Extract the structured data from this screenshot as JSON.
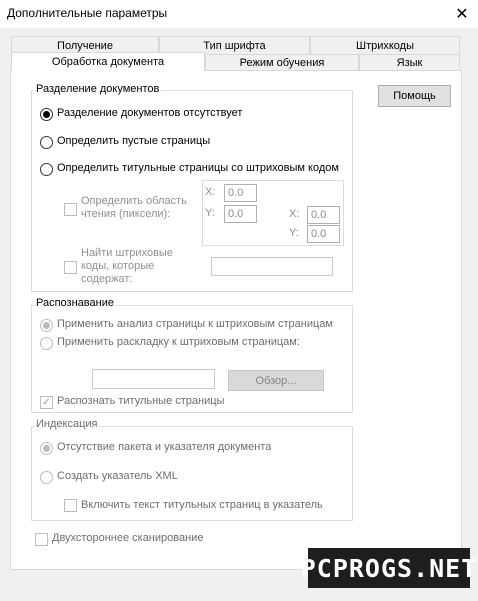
{
  "window": {
    "title": "Дополнительные параметры",
    "close_glyph": "✕"
  },
  "tabs": {
    "row1": [
      "Получение",
      "Тип шрифта",
      "Штрихкоды"
    ],
    "row2": [
      "Обработка документа",
      "Режим обучения",
      "Язык"
    ]
  },
  "help_button": "Помощь",
  "separation": {
    "label": "Разделение документов",
    "options": [
      "Разделение документов отсутствует",
      "Определить пустые страницы",
      "Определить титульные страницы со штриховым кодом"
    ],
    "read_area_label": "Определить область чтения (пиксели):",
    "coords": {
      "x1_label": "X:",
      "x1": "0.0",
      "y1_label": "Y:",
      "y1": "0.0",
      "x2_label": "X:",
      "x2": "0.0",
      "y2_label": "Y:",
      "y2": "0.0"
    },
    "find_barcodes_label": "Найти штриховые коды, которые содержат:",
    "find_barcodes_value": ""
  },
  "recognition": {
    "label": "Распознавание",
    "options": [
      "Применить анализ страницы к штриховым страницам",
      "Применить раскладку к штриховым страницам:"
    ],
    "path_value": "",
    "browse": "Обзор...",
    "recognize_title_label": "Распознать титульные страницы",
    "recognize_title_checkmark": "✓"
  },
  "indexing": {
    "label": "Индексация",
    "options": [
      "Отсутствие пакета и указателя документа",
      "Создать указатель XML"
    ],
    "include_title_text_label": "Включить текст титульных страниц в указатель"
  },
  "duplex_label": "Двухстороннее сканирование",
  "watermark": "PCPROGS.NET"
}
